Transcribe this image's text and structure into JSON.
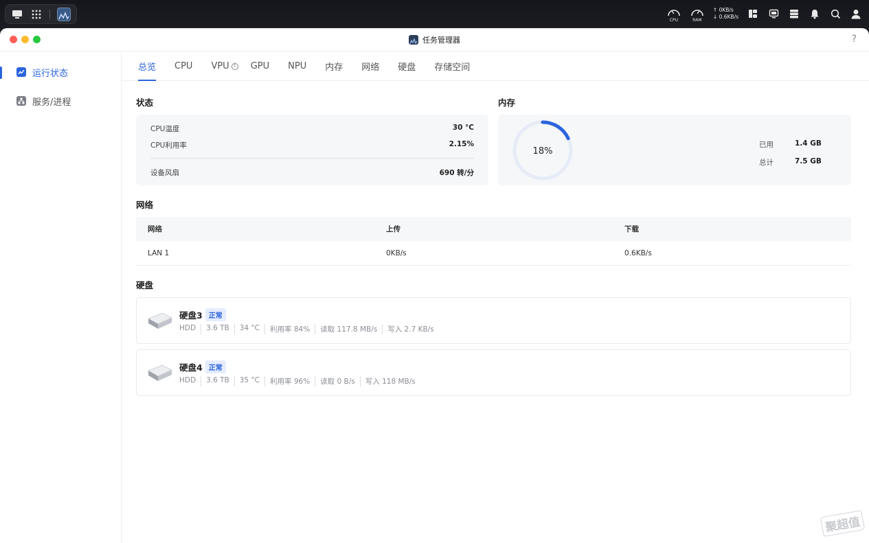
{
  "sysbar": {
    "gauges": [
      {
        "label": "CPU"
      },
      {
        "label": "RAM"
      }
    ],
    "net": {
      "up": "↑ 0KB/s",
      "down": "↓ 0.6KB/s"
    }
  },
  "window": {
    "title": "任务管理器",
    "help": "?"
  },
  "sidebar": {
    "items": [
      {
        "label": "运行状态",
        "icon": "chart-icon",
        "active": true
      },
      {
        "label": "服务/进程",
        "icon": "sitemap-icon",
        "active": false
      }
    ]
  },
  "tabs": [
    {
      "label": "总览",
      "active": true
    },
    {
      "label": "CPU"
    },
    {
      "label": "VPU"
    },
    {
      "label": "GPU"
    },
    {
      "label": "NPU"
    },
    {
      "label": "内存"
    },
    {
      "label": "网络"
    },
    {
      "label": "硬盘"
    },
    {
      "label": "存储空间"
    }
  ],
  "status": {
    "title": "状态",
    "rows": [
      {
        "label": "CPU温度",
        "value": "30 °C"
      },
      {
        "label": "CPU利用率",
        "value": "2.15%"
      },
      {
        "label": "设备风扇",
        "value": "690 转/分"
      }
    ]
  },
  "memory": {
    "title": "内存",
    "percent_label": "18%",
    "percent": 0.18,
    "used_label": "已用",
    "used_value": "1.4 GB",
    "total_label": "总计",
    "total_value": "7.5 GB",
    "accent": "#2b64dd"
  },
  "network": {
    "title": "网络",
    "headers": [
      "网络",
      "上传",
      "下载"
    ],
    "rows": [
      {
        "name": "LAN 1",
        "upload": "0KB/s",
        "download": "0.6KB/s"
      }
    ]
  },
  "disks": {
    "title": "硬盘",
    "items": [
      {
        "name": "硬盘3",
        "status": "正常",
        "type": "HDD",
        "capacity": "3.6 TB",
        "temp": "34 °C",
        "usage": "利用率 84%",
        "read": "读取 117.8 MB/s",
        "write": "写入 2.7 KB/s"
      },
      {
        "name": "硬盘4",
        "status": "正常",
        "type": "HDD",
        "capacity": "3.6 TB",
        "temp": "35 °C",
        "usage": "利用率 96%",
        "read": "读取 0 B/s",
        "write": "写入 118 MB/s"
      }
    ]
  },
  "watermark": "聚超值"
}
